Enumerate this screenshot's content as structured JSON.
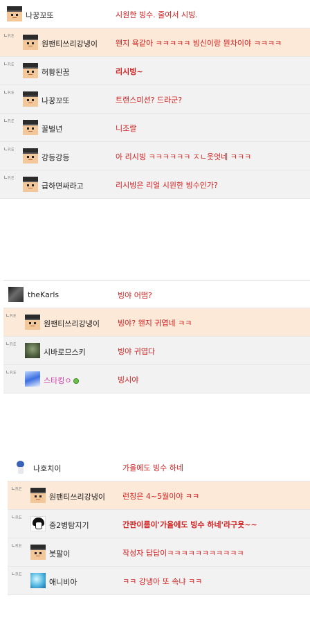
{
  "threads": [
    {
      "comments": [
        {
          "nick": "나꿍꼬또",
          "text": "시원한 빙수. 줄여서 시빙.",
          "avatar": "pixel-face-icon"
        },
        {
          "nick": "원팬티쓰리강냉이",
          "text": "왠지 욕같아 ㅋㅋㅋㅋㅋ 빙신이랑 뭔차이야 ㅋㅋㅋㅋ",
          "avatar": "pixel-face-icon",
          "highlight": true
        },
        {
          "nick": "허황된꿈",
          "text": "리시빙~",
          "avatar": "pixel-face-icon",
          "bold": true
        },
        {
          "nick": "나꿍꼬또",
          "text": "트랜스미션? 드라군?",
          "avatar": "pixel-face-icon"
        },
        {
          "nick": "꿀벌년",
          "text": "니조랄",
          "avatar": "pixel-face-icon"
        },
        {
          "nick": "강등강등",
          "text": "아 리시빙 ㅋㅋㅋㅋㅋㅋ ㅈㄴ웃엇네 ㅋㅋㅋ",
          "avatar": "pixel-face-icon"
        },
        {
          "nick": "급하면싸라고",
          "text": "리시빙은 리얼 시원한 빙수인가?",
          "avatar": "pixel-face-icon"
        }
      ]
    },
    {
      "comments": [
        {
          "nick": "theKarls",
          "text": "빙야 어떰?",
          "avatar": "dark-photo-icon"
        },
        {
          "nick": "원팬티쓰리강냉이",
          "text": "빙야? 왠지 귀엽네 ㅋㅋ",
          "avatar": "pixel-face-icon",
          "highlight": true
        },
        {
          "nick": "시바로므스키",
          "text": "빙야 귀엽다",
          "avatar": "green-photo-icon"
        },
        {
          "nick": "스타킹ㅇ",
          "text": "빙시야",
          "avatar": "anime-avatar-icon",
          "pink": true,
          "online": true
        }
      ]
    },
    {
      "comments": [
        {
          "nick": "나호치이",
          "text": "가을에도 빙수 하네",
          "avatar": "doll-icon"
        },
        {
          "nick": "원팬티쓰리강냉이",
          "text": "런칭은 4~5월이야 ㅋㅋ",
          "avatar": "pixel-face-icon",
          "highlight": true
        },
        {
          "nick": "중2병탐지기",
          "text": "간판이름이'가을에도 빙수 하네'라구욧~~",
          "avatar": "girl-drawing-icon",
          "bold": true
        },
        {
          "nick": "붓팔이",
          "text": "작성자 답답이ㅋㅋㅋㅋㅋㅋㅋㅋㅋㅋㅋ",
          "avatar": "pixel-face-icon"
        },
        {
          "nick": "애니비아",
          "text": "ㅋㅋ 강냉아 또 속냐 ㅋㅋ",
          "avatar": "ice-icon"
        }
      ]
    }
  ],
  "reply_marker": "RE",
  "colors": {
    "message": "#d21f1f",
    "highlight_row": "#fde9d8",
    "row": "#f2f2f2",
    "pink_nick": "#d43fa8"
  }
}
